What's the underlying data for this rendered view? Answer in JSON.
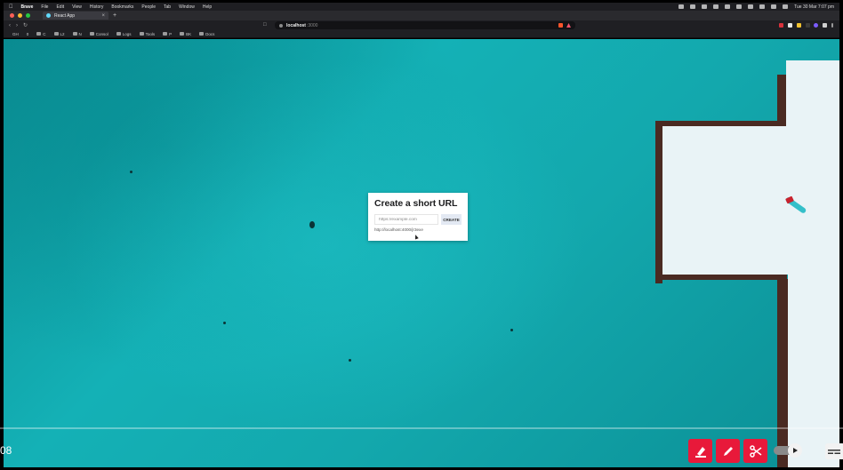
{
  "menubar": {
    "app_name": "Brave",
    "items": [
      "File",
      "Edit",
      "View",
      "History",
      "Bookmarks",
      "People",
      "Tab",
      "Window",
      "Help"
    ],
    "clock": "Tue 30 Mar  7:07 pm"
  },
  "browser": {
    "tab_title": "React App",
    "tab_close": "×",
    "new_tab": "+",
    "address_host": "localhost",
    "address_port": ":3000",
    "bookmarks": [
      {
        "label": "GH"
      },
      {
        "label": "0"
      },
      {
        "label": "C"
      },
      {
        "label": "L2"
      },
      {
        "label": "N"
      },
      {
        "label": "Consol"
      },
      {
        "label": "Logs"
      },
      {
        "label": "Tools"
      },
      {
        "label": "P"
      },
      {
        "label": "BK"
      },
      {
        "label": "Docs"
      }
    ]
  },
  "card": {
    "title": "Create a short URL",
    "input_placeholder": "https://example.com",
    "create_label": "CREATE",
    "result_url": "http://localhost:4000/jr3exe"
  },
  "player": {
    "timecode": "08"
  },
  "colors": {
    "accent_red": "#e8193a",
    "water": "#13a8ad",
    "snow": "#e9f3f6"
  }
}
